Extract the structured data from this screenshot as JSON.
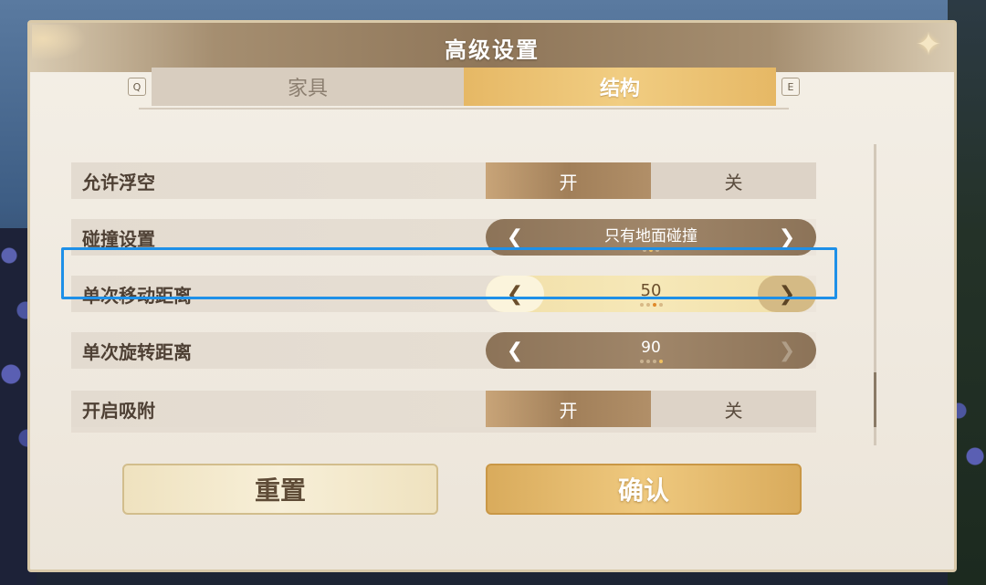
{
  "dialog": {
    "title": "高级设置"
  },
  "tabs": {
    "prev_key": "Q",
    "next_key": "E",
    "items": [
      {
        "label": "家具",
        "active": false
      },
      {
        "label": "结构",
        "active": true
      }
    ]
  },
  "settings": [
    {
      "label": "允许浮空",
      "type": "toggle",
      "on_label": "开",
      "off_label": "关",
      "value": "开"
    },
    {
      "label": "碰撞设置",
      "type": "stepper",
      "value": "只有地面碰撞",
      "option_index": 2,
      "option_count": 3
    },
    {
      "label": "单次移动距离",
      "type": "stepper",
      "value": "50",
      "option_index": 3,
      "option_count": 4,
      "focused": true
    },
    {
      "label": "单次旋转距离",
      "type": "stepper",
      "value": "90",
      "option_index": 4,
      "option_count": 4
    },
    {
      "label": "开启吸附",
      "type": "toggle",
      "on_label": "开",
      "off_label": "关",
      "value": "开"
    }
  ],
  "buttons": {
    "reset": "重置",
    "confirm": "确认"
  },
  "colors": {
    "highlight": "#1e90e8",
    "accent_gold": "#e6b865"
  }
}
